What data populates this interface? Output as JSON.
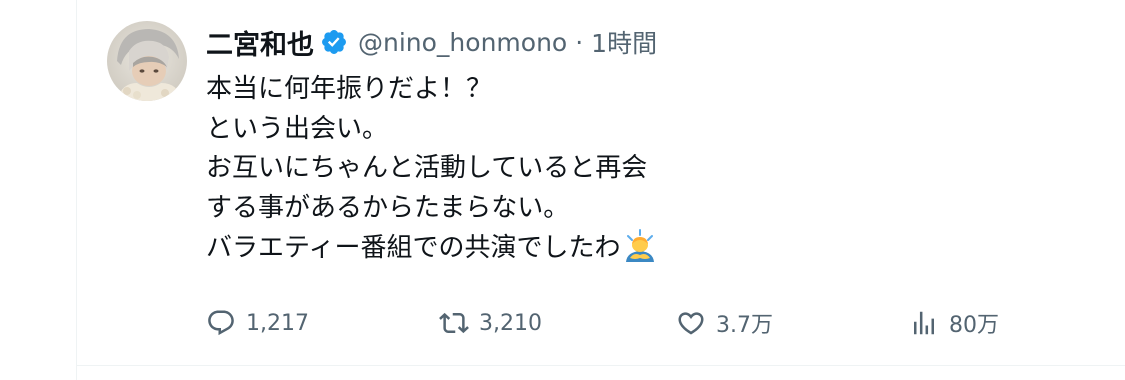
{
  "author": {
    "display_name": "二宮和也",
    "handle": "@nino_honmono",
    "separator": "·",
    "time": "1時間",
    "verified": true
  },
  "tweet": {
    "lines": [
      "本当に何年振りだよ！？",
      "という出会い。",
      "お互いにちゃんと活動していると再会",
      "する事があるからたまらない。",
      "バラエティー番組での共演でしたわ"
    ],
    "trailing_emoji": "person-bowing-emoji"
  },
  "actions": {
    "replies": "1,217",
    "reposts": "3,210",
    "likes": "3.7万",
    "views": "80万"
  },
  "colors": {
    "verified": "#1d9bf0",
    "text": "#0f1419",
    "secondary": "#536471",
    "border": "#eff3f4"
  },
  "icons": [
    "reply-icon",
    "repost-icon",
    "like-icon",
    "views-icon",
    "verified-badge-icon"
  ]
}
